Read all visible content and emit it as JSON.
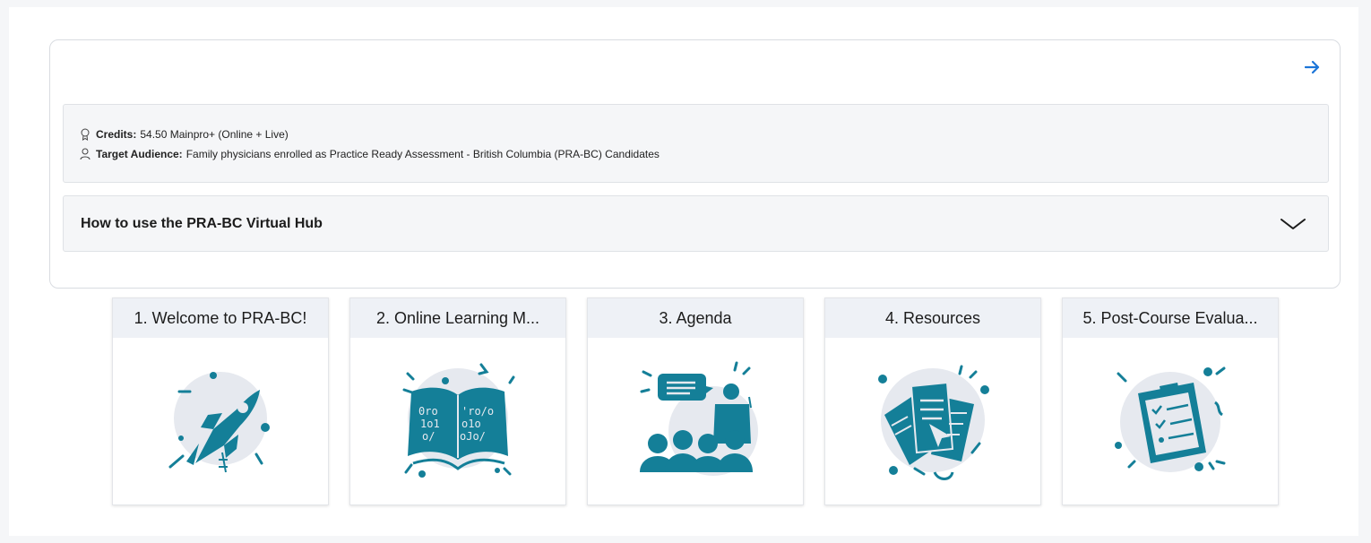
{
  "course": {
    "credits_label": "Credits:",
    "credits_value": "54.50 Mainpro+ (Online + Live)",
    "audience_label": "Target Audience:",
    "audience_value": "Family physicians enrolled as Practice Ready Assessment - British Columbia (PRA-BC) Candidates",
    "accordion_title": "How to use the PRA-BC Virtual Hub"
  },
  "icons": {
    "arrow": "arrow-right-icon",
    "credits": "award-icon",
    "audience": "person-icon",
    "chevron": "chevron-down-icon"
  },
  "tiles": [
    {
      "label": "1. Welcome to PRA-BC!"
    },
    {
      "label": "2. Online Learning M..."
    },
    {
      "label": "3. Agenda"
    },
    {
      "label": "4. Resources"
    },
    {
      "label": "5. Post-Course Evalua..."
    }
  ],
  "colors": {
    "accent": "#1c75d8",
    "illustration": "#147f98",
    "illustration_bg": "#e6e9ef"
  }
}
